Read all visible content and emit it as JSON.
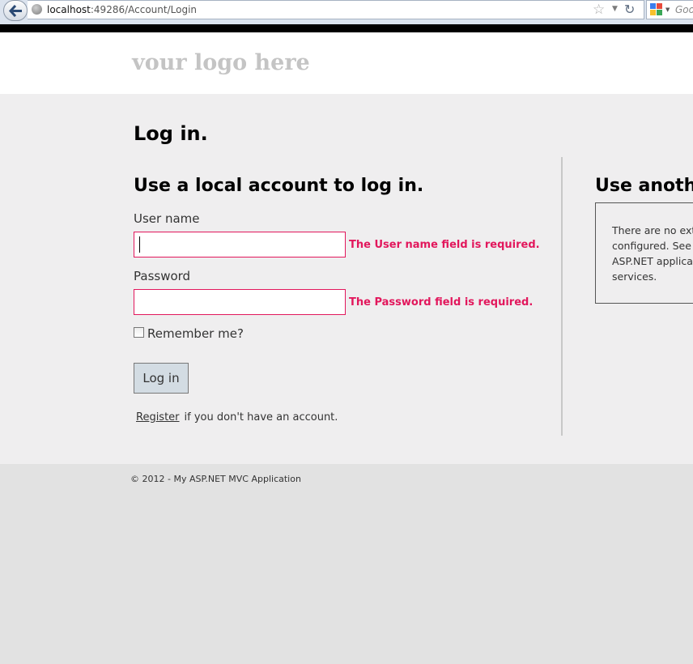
{
  "browser": {
    "url_host": "localhost",
    "url_rest": ":49286/Account/Login",
    "search_placeholder": "Goog"
  },
  "header": {
    "logo_text": "your logo here"
  },
  "main": {
    "page_title": "Log in.",
    "local_section_title": "Use a local account to log in.",
    "username_label": "User name",
    "username_value": "",
    "username_error": "The User name field is required.",
    "password_label": "Password",
    "password_value": "",
    "password_error": "The Password field is required.",
    "remember_label": "Remember me?",
    "remember_checked": false,
    "login_button_label": "Log in",
    "register_link": "Register",
    "register_suffix": "if you don't have an account."
  },
  "external": {
    "title": "Use anothe",
    "text_lines": [
      "There are no ext",
      "configured. See",
      "ASP.NET applicat",
      "services."
    ]
  },
  "footer": {
    "copyright": "© 2012 - My ASP.NET MVC Application"
  },
  "colors": {
    "error": "#e2175c",
    "button_bg": "#d3dce3",
    "content_bg": "#efeeef",
    "page_bg": "#e2e2e2"
  }
}
